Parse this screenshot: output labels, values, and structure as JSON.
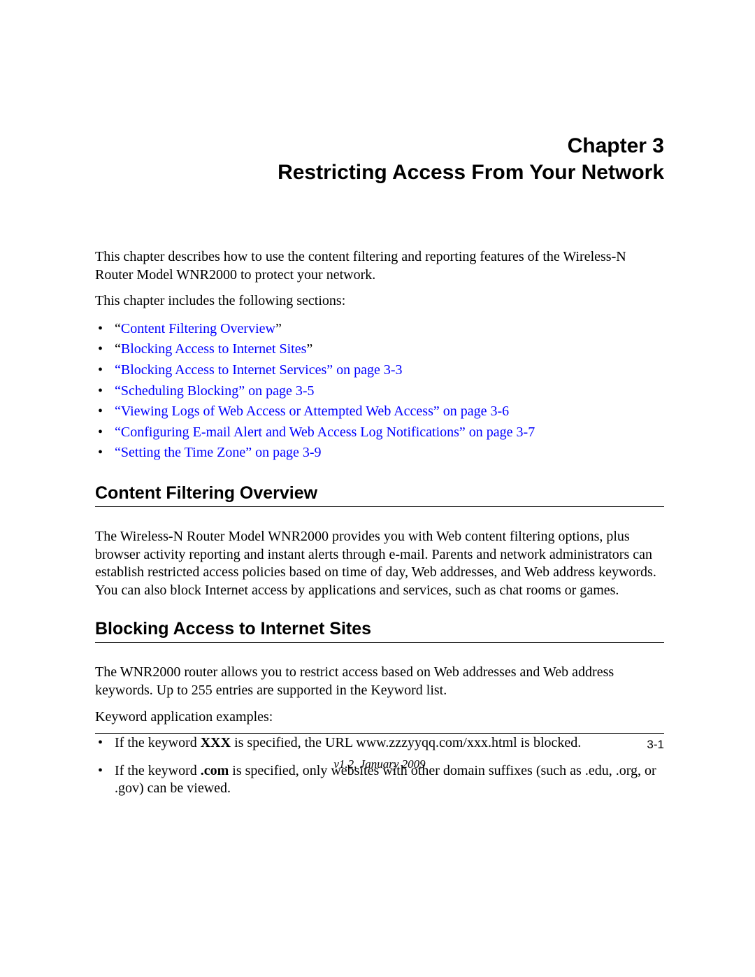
{
  "chapter": {
    "label": "Chapter 3",
    "title": "Restricting Access From Your Network"
  },
  "intro": {
    "p1": "This chapter describes how to use the content filtering and reporting features of the Wireless-N Router Model WNR2000  to protect your network.",
    "p2": "This chapter includes the following sections:"
  },
  "toc": [
    {
      "pre": "“",
      "link": "Content Filtering Overview",
      "post": "”"
    },
    {
      "pre": "“",
      "link": "Blocking Access to Internet Sites",
      "post": "”"
    },
    {
      "pre": "",
      "link": "“Blocking Access to Internet Services” on page 3-3",
      "post": ""
    },
    {
      "pre": "",
      "link": "“Scheduling Blocking” on page 3-5",
      "post": ""
    },
    {
      "pre": "",
      "link": "“Viewing Logs of Web Access or Attempted Web Access” on page 3-6",
      "post": ""
    },
    {
      "pre": "",
      "link": "“Configuring E-mail Alert and Web Access Log Notifications” on page 3-7",
      "post": ""
    },
    {
      "pre": "",
      "link": "“Setting the Time Zone” on page 3-9",
      "post": ""
    }
  ],
  "section1": {
    "heading": "Content Filtering Overview",
    "p1": "The Wireless-N Router Model WNR2000  provides you with Web content filtering options, plus browser activity reporting and instant alerts through e-mail. Parents and network administrators can establish restricted access policies based on time of day, Web addresses, and Web address keywords. You can also block Internet access by applications and services, such as chat rooms or games."
  },
  "section2": {
    "heading": "Blocking Access to Internet Sites",
    "p1": "The WNR2000 router allows you to restrict access based on Web addresses and Web address keywords. Up to 255 entries are supported in the Keyword list.",
    "p2": "Keyword application examples:",
    "ex1_pre": "If the keyword ",
    "ex1_bold": "XXX",
    "ex1_post": " is specified, the URL www.zzzyyqq.com/xxx.html is blocked.",
    "ex2_pre": "If the keyword ",
    "ex2_bold": ".com",
    "ex2_post": " is specified, only websites with other domain suffixes (such as .edu, .org, or .gov) can be viewed."
  },
  "footer": {
    "pagenum": "3-1",
    "version": "v1.2, January 2009"
  }
}
